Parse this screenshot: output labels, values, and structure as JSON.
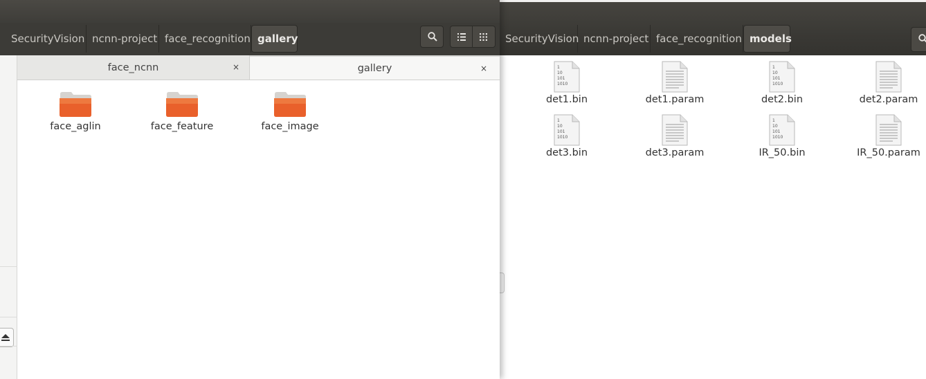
{
  "back_window": {
    "breadcrumbs": [
      "SecurityVision",
      "ncnn-project",
      "face_recognition",
      "models"
    ],
    "files": [
      {
        "name": "det1.bin",
        "kind": "binary"
      },
      {
        "name": "det1.param",
        "kind": "text"
      },
      {
        "name": "det2.bin",
        "kind": "binary"
      },
      {
        "name": "det2.param",
        "kind": "text"
      },
      {
        "name": "det3.bin",
        "kind": "binary"
      },
      {
        "name": "det3.param",
        "kind": "text"
      },
      {
        "name": "IR_50.bin",
        "kind": "binary"
      },
      {
        "name": "IR_50.param",
        "kind": "text"
      }
    ],
    "binary_icon_lines": [
      "1",
      "10",
      "101",
      "1010"
    ]
  },
  "front_window": {
    "breadcrumbs": [
      "SecurityVision",
      "ncnn-project",
      "face_recognition",
      "gallery"
    ],
    "tabs": [
      {
        "label": "face_ncnn",
        "active": false,
        "close": "×"
      },
      {
        "label": "gallery",
        "active": true,
        "close": "×"
      }
    ],
    "folders": [
      {
        "name": "face_aglin"
      },
      {
        "name": "face_feature"
      },
      {
        "name": "face_image"
      }
    ],
    "icons": {
      "search": "search-icon",
      "list_view": "list-view-icon",
      "grid_view": "grid-view-icon",
      "eject": "eject-icon",
      "folder": "folder-icon"
    }
  },
  "colors": {
    "toolbar_dark": "#3c3b37",
    "folder_orange": "#e9602b",
    "text": "#333333"
  }
}
